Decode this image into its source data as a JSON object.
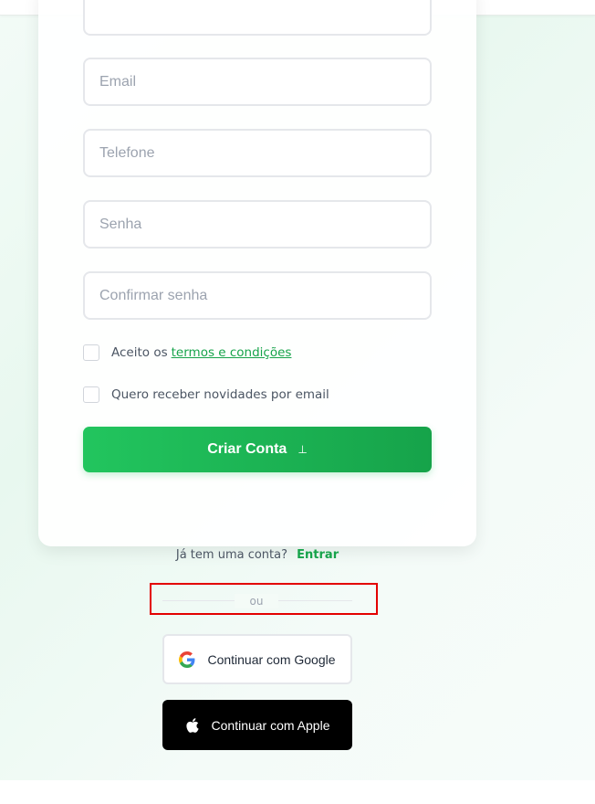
{
  "form": {
    "email_placeholder": "Email",
    "phone_placeholder": "Telefone",
    "password_placeholder": "Senha",
    "confirm_password_placeholder": "Confirmar senha",
    "terms_prefix": "Aceito os",
    "terms_link": "termos e condições",
    "newsletter_label": "Quero receber novidades por email",
    "submit_label": "Criar Conta",
    "submit_icon": "arrow-down-to-line-icon"
  },
  "login_prompt": {
    "text": "Já tem uma conta?",
    "link": "Entrar"
  },
  "divider_text": "ou",
  "social": {
    "google_label": "Continuar com Google",
    "apple_label": "Continuar com Apple"
  },
  "colors": {
    "accent": "#22c55e",
    "accent_dark": "#16a34a",
    "highlight": "#e30000"
  }
}
